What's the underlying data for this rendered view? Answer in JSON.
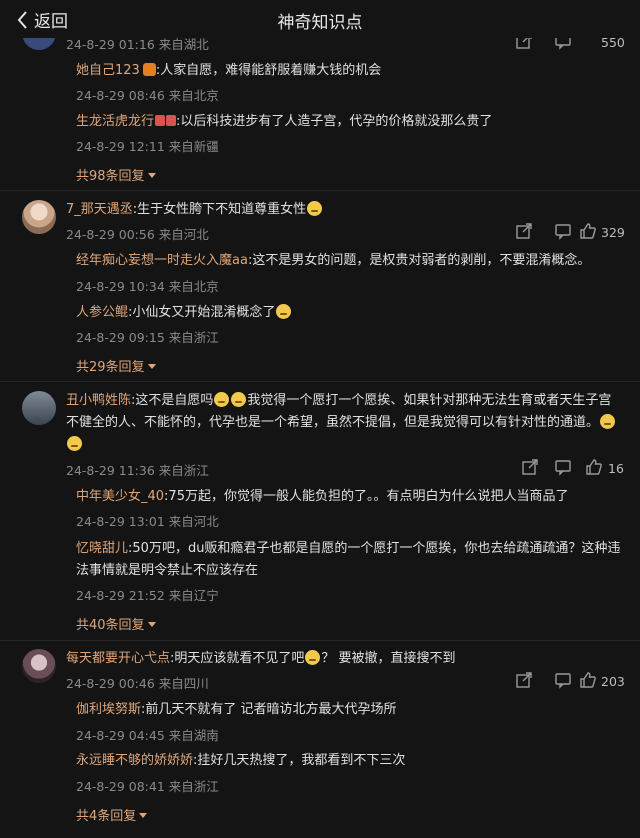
{
  "header": {
    "back_label": "返回",
    "title": "神奇知识点"
  },
  "top_partial": {
    "meta": "24-8-29 01:16 来自湖北",
    "like_count": "550"
  },
  "c0_replies": [
    {
      "name": "她自己123",
      "text": ":人家自愿，难得能舒服着赚大钱的机会",
      "meta": "24-8-29 08:46 来自北京"
    },
    {
      "name": "生龙活虎龙行",
      "text": ":以后科技进步有了人造子宫，代孕的价格就没那么贵了",
      "meta": "24-8-29 12:11 来自新疆"
    }
  ],
  "c0_more": "共98条回复",
  "c1": {
    "name": "7_那天遇丞",
    "text": ":生于女性胯下不知道尊重女性",
    "meta": "24-8-29 00:56 来自河北",
    "like_count": "329",
    "replies": [
      {
        "name": "经年痴心妄想一时走火入魔aa",
        "text": ":这不是男女的问题，是权贵对弱者的剥削，不要混淆概念。",
        "meta": "24-8-29 10:34 来自北京"
      },
      {
        "name": "人参公鲲",
        "text": ":小仙女又开始混淆概念了",
        "meta": "24-8-29 09:15 来自浙江"
      }
    ],
    "more": "共29条回复"
  },
  "c2": {
    "name": "丑小鸭姓陈",
    "text_a": ":这不是自愿吗",
    "text_b": "我觉得一个愿打一个愿挨、如果针对那种无法生育或者天生子宫",
    "line2": "不健全的人、不能怀的，代孕也是一个希望，虽然不提倡，但是我觉得可以有针对性的通道。",
    "meta": "24-8-29 11:36 来自浙江",
    "like_count": "16",
    "replies": [
      {
        "name": "中年美少女_40",
        "text": ":75万起，你觉得一般人能负担的了。。有点明白为什么说把人当商品了",
        "meta": "24-8-29 13:01 来自河北"
      },
      {
        "name": "忆晓甜儿",
        "text": ":50万吧，du贩和瘾君子也都是自愿的一个愿打一个愿挨，你也去给疏通疏通？这种违",
        "line2": "法事情就是明令禁止不应该存在",
        "meta": "24-8-29 21:52 来自辽宁"
      }
    ],
    "more": "共40条回复"
  },
  "c3": {
    "name": "每天都要开心弋点",
    "text_a": ":明天应该就看不见了吧",
    "text_b": "？ 要被撤，直接搜不到",
    "meta": "24-8-29 00:46 来自四川",
    "like_count": "203",
    "replies": [
      {
        "name": "伽利埃努斯",
        "text": ":前几天不就有了 记者暗访北方最大代孕场所",
        "meta": "24-8-29 04:45 来自湖南"
      },
      {
        "name": "永远睡不够的娇娇娇",
        "text": ":挂好几天热搜了，我都看到不下三次",
        "meta": "24-8-29 08:41 来自浙江"
      }
    ],
    "more": "共4条回复"
  }
}
